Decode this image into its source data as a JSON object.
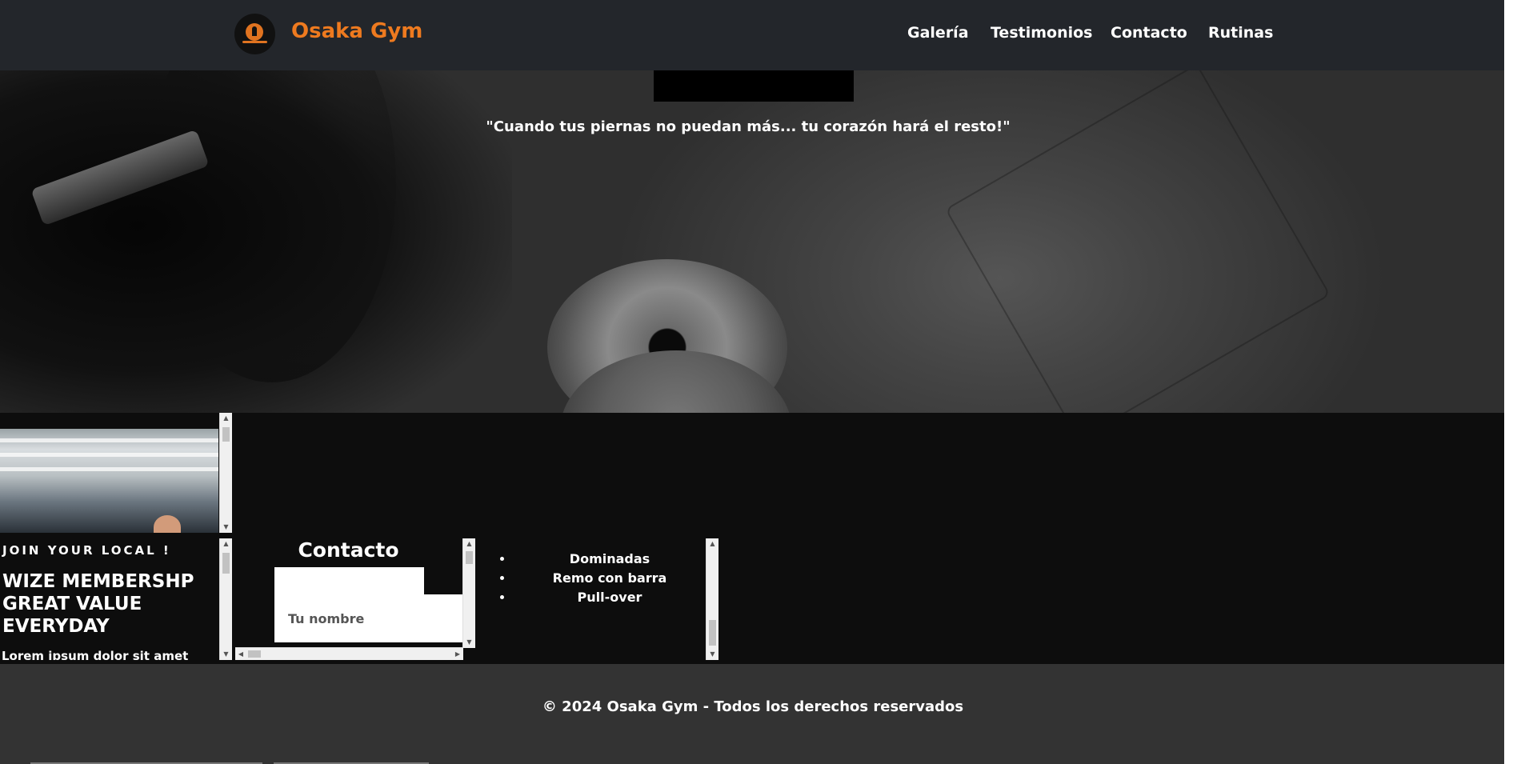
{
  "header": {
    "brand": "Osaka Gym",
    "nav": [
      "Galería",
      "Testimonios",
      "Contacto",
      "Rutinas"
    ]
  },
  "hero": {
    "quote": "\"Cuando tus piernas no puedan más... tu corazón hará el resto!\""
  },
  "join": {
    "eyebrow": "JOIN YOUR LOCAL !",
    "headline": "WIZE MEMBERSHP GREAT VALUE EVERYDAY",
    "body": "Lorem ipsum dolor sit amet"
  },
  "contact": {
    "title": "Contacto",
    "name_placeholder": "Tu nombre"
  },
  "routine": {
    "exercises": [
      "Dominadas",
      "Remo con barra",
      "Pull-over"
    ]
  },
  "footer": {
    "text": "© 2024 Osaka Gym - Todos los derechos reservados"
  },
  "colors": {
    "brand": "#ee7a1f",
    "nav_bg": "#23262b",
    "footer_bg": "#333333",
    "page_bg": "#0d0d0d"
  }
}
